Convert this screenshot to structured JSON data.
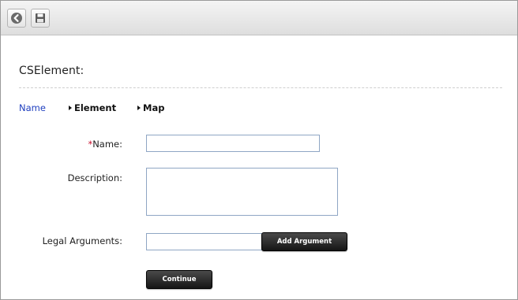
{
  "toolbar": {
    "back_icon": "back-arrow-icon",
    "save_icon": "save-disk-icon"
  },
  "page": {
    "title": "CSElement:"
  },
  "tabs": [
    {
      "label": "Name",
      "active": true
    },
    {
      "label": "Element",
      "active": false
    },
    {
      "label": "Map",
      "active": false
    }
  ],
  "form": {
    "name": {
      "required_mark": "*",
      "label": "Name:",
      "value": ""
    },
    "description": {
      "label": "Description:",
      "value": ""
    },
    "legal_arguments": {
      "label": "Legal Arguments:",
      "value": ""
    },
    "add_argument_label": "Add Argument",
    "continue_label": "Continue"
  },
  "colors": {
    "active_tab": "#1f3fbf",
    "required": "#c8102e",
    "button_bg": "#1f1f1f",
    "input_border": "#8fa6c4"
  }
}
